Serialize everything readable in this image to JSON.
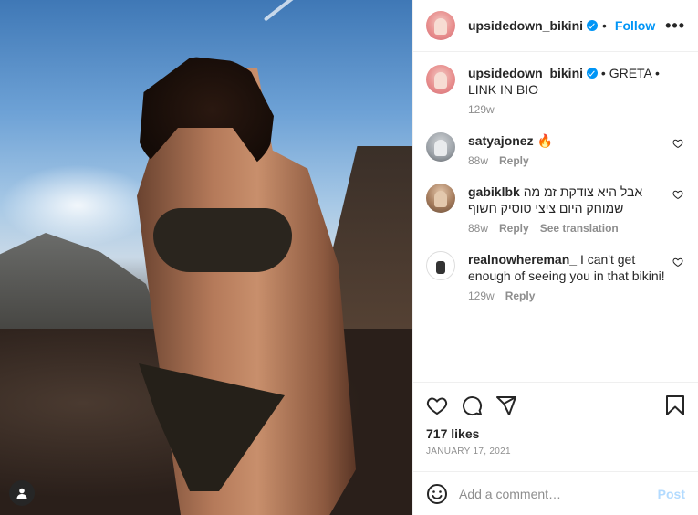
{
  "post": {
    "username": "upsidedown_bikini",
    "follow_label": "Follow",
    "more_label": "•••",
    "caption": "• GRETA • LINK IN BIO",
    "caption_age": "129w",
    "likes": "717 likes",
    "date": "January 17, 2021"
  },
  "comments": [
    {
      "user": "satyajonez",
      "text": "🔥",
      "age": "88w",
      "reply": "Reply",
      "translate": ""
    },
    {
      "user": "gabiklbk",
      "text": "אבל היא צודקת זמ מה שמוחק היום ציצי טוסיק חשוף",
      "age": "88w",
      "reply": "Reply",
      "translate": "See translation"
    },
    {
      "user": "realnowhereman_",
      "text": "I can't get enough of seeing you in that bikini!",
      "age": "129w",
      "reply": "Reply",
      "translate": ""
    }
  ],
  "composer": {
    "placeholder": "Add a comment…",
    "post_label": "Post"
  },
  "colors": {
    "accent": "#0095f6",
    "text": "#262626",
    "muted": "#8e8e8e"
  },
  "icons": {
    "like": "heart-icon",
    "comment": "comment-icon",
    "share": "share-icon",
    "save": "bookmark-icon",
    "emoji": "emoji-icon",
    "tag": "user-tag-icon"
  }
}
